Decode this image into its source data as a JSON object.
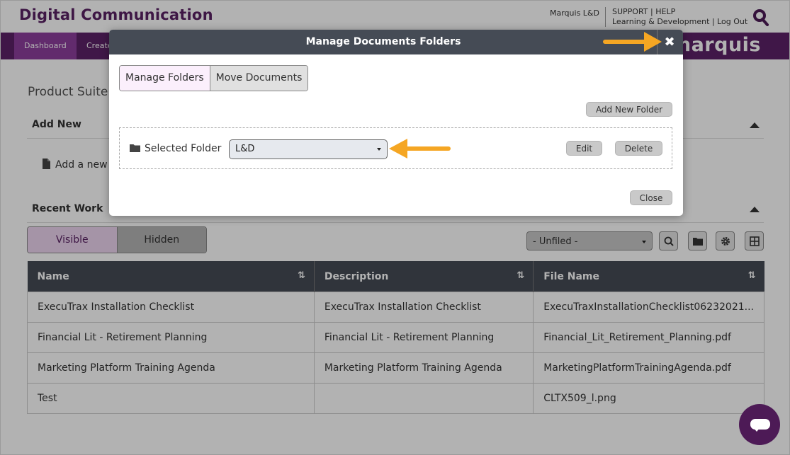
{
  "header": {
    "app_title": "Digital Communication",
    "user": "Marquis L&D",
    "links_line1": "SUPPORT | HELP",
    "links_line2": "Learning & Development | Log Out"
  },
  "nav": {
    "tabs": [
      "Dashboard",
      "Create"
    ],
    "logo": "marquis"
  },
  "main": {
    "suite_title": "Product Suite",
    "add_new": {
      "title": "Add New",
      "link": "Add a new"
    },
    "recent_work": {
      "title": "Recent Work"
    },
    "visibility": {
      "visible": "Visible",
      "hidden": "Hidden"
    },
    "filter": {
      "value": "- Unfiled -"
    },
    "table": {
      "columns": [
        "Name",
        "Description",
        "File Name"
      ],
      "rows": [
        [
          "ExecuTrax Installation Checklist",
          "ExecuTrax Installation Checklist",
          "ExecuTraxInstallationChecklist06232021..."
        ],
        [
          "Financial Lit - Retirement Planning",
          "Financial Lit - Retirement Planning",
          "Financial_Lit_Retirement_Planning.pdf"
        ],
        [
          "Marketing Platform Training Agenda",
          "Marketing Platform Training Agenda",
          "MarketingPlatformTrainingAgenda.pdf"
        ],
        [
          "Test",
          "",
          "CLTX509_l.png"
        ]
      ]
    }
  },
  "modal": {
    "title": "Manage Documents Folders",
    "close_x": "✖",
    "tabs": [
      "Manage Folders",
      "Move Documents"
    ],
    "add_folder": "Add New Folder",
    "selected_folder_label": "Selected Folder",
    "selected_folder_value": "L&D",
    "edit": "Edit",
    "delete": "Delete",
    "close": "Close"
  },
  "colors": {
    "brand_purple": "#5c2167",
    "accent_orange": "#f5a623",
    "header_dark": "#454b55"
  }
}
